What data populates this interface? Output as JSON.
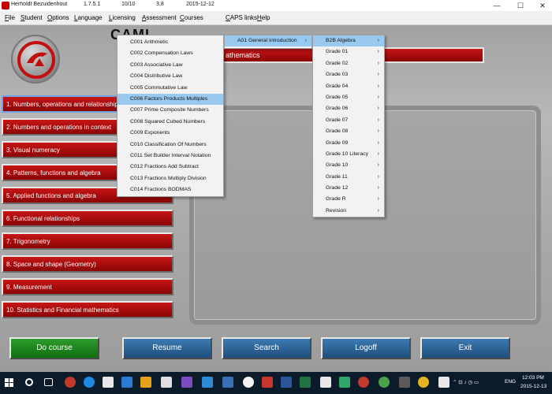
{
  "titlebar": {
    "user": "Herholdt Bezuidenhout",
    "version": "1.7.5.1",
    "score": "10/10",
    "value": "3,8",
    "date": "2015-12-12"
  },
  "menu": [
    {
      "label": "File",
      "ul": "F",
      "rest": "ile"
    },
    {
      "label": "Student",
      "ul": "S",
      "rest": "tudent"
    },
    {
      "label": "Options",
      "ul": "O",
      "rest": "ptions"
    },
    {
      "label": "Language",
      "ul": "L",
      "rest": "anguage"
    },
    {
      "label": "Licensing",
      "ul": "L",
      "rest": "icensing"
    },
    {
      "label": "Assessment",
      "ul": "A",
      "rest": "ssessment"
    },
    {
      "label": "Courses",
      "ul": "C",
      "rest": "ourses"
    },
    {
      "label": "CAPS links",
      "ul": "C",
      "rest": "APS links"
    },
    {
      "label": "Help",
      "ul": "H",
      "rest": "elp"
    }
  ],
  "app_title": "CAMI",
  "header_text": "athematics",
  "topics": [
    "1. Numbers, operations and relationships",
    "2. Numbers and operations in context",
    "3. Visual numeracy",
    "4. Patterns, functions and algebra",
    "5. Applied functions and algebra",
    "6. Functional relationships",
    "7. Trigonometry",
    "8. Space and shape (Geometry)",
    "9. Measurement",
    "10. Statistics and Financial mathematics"
  ],
  "course_menu": [
    "C001 Arithmetic",
    "C002 Compensation Laws",
    "C003 Associative Law",
    "C004 Distributive Law",
    "C005 Commutative Law",
    "C006 Factors Products Multiples",
    "C007 Prime Composite Numbers",
    "C008 Squared Cubed Numbers",
    "C009 Exponents",
    "C010 Classification Of Numbers",
    "C011 Set Builder Interval Notation",
    "C012 Fractions Add Subtract",
    "C013 Fractions Multiply Division",
    "C014 Fractions BODMAS"
  ],
  "course_selected": "C006 Factors Products Multiples",
  "intro_menu": [
    "A01 General Introduction"
  ],
  "grade_menu": [
    "B2B Algebra",
    "Grade 01",
    "Grade 02",
    "Grade 03",
    "Grade 04",
    "Grade 05",
    "Grade 06",
    "Grade 07",
    "Grade 08",
    "Grade 09",
    "Grade 10 Literacy",
    "Grade 10",
    "Grade 11",
    "Grade 12",
    "Grade R",
    "Revision"
  ],
  "buttons": {
    "do_course": "Do course",
    "resume": "Resume",
    "search": "Search",
    "logoff": "Logoff",
    "exit": "Exit"
  },
  "taskbar": {
    "time": "12:03 PM",
    "date": "2015-12-13",
    "lang": "ENG"
  },
  "colors": {
    "topic_red": "#a80c0c",
    "menu_highlight": "#99c9ef",
    "do_course_green": "#1f861f",
    "action_blue": "#2d66a0",
    "taskbar": "#0c1b2a"
  }
}
